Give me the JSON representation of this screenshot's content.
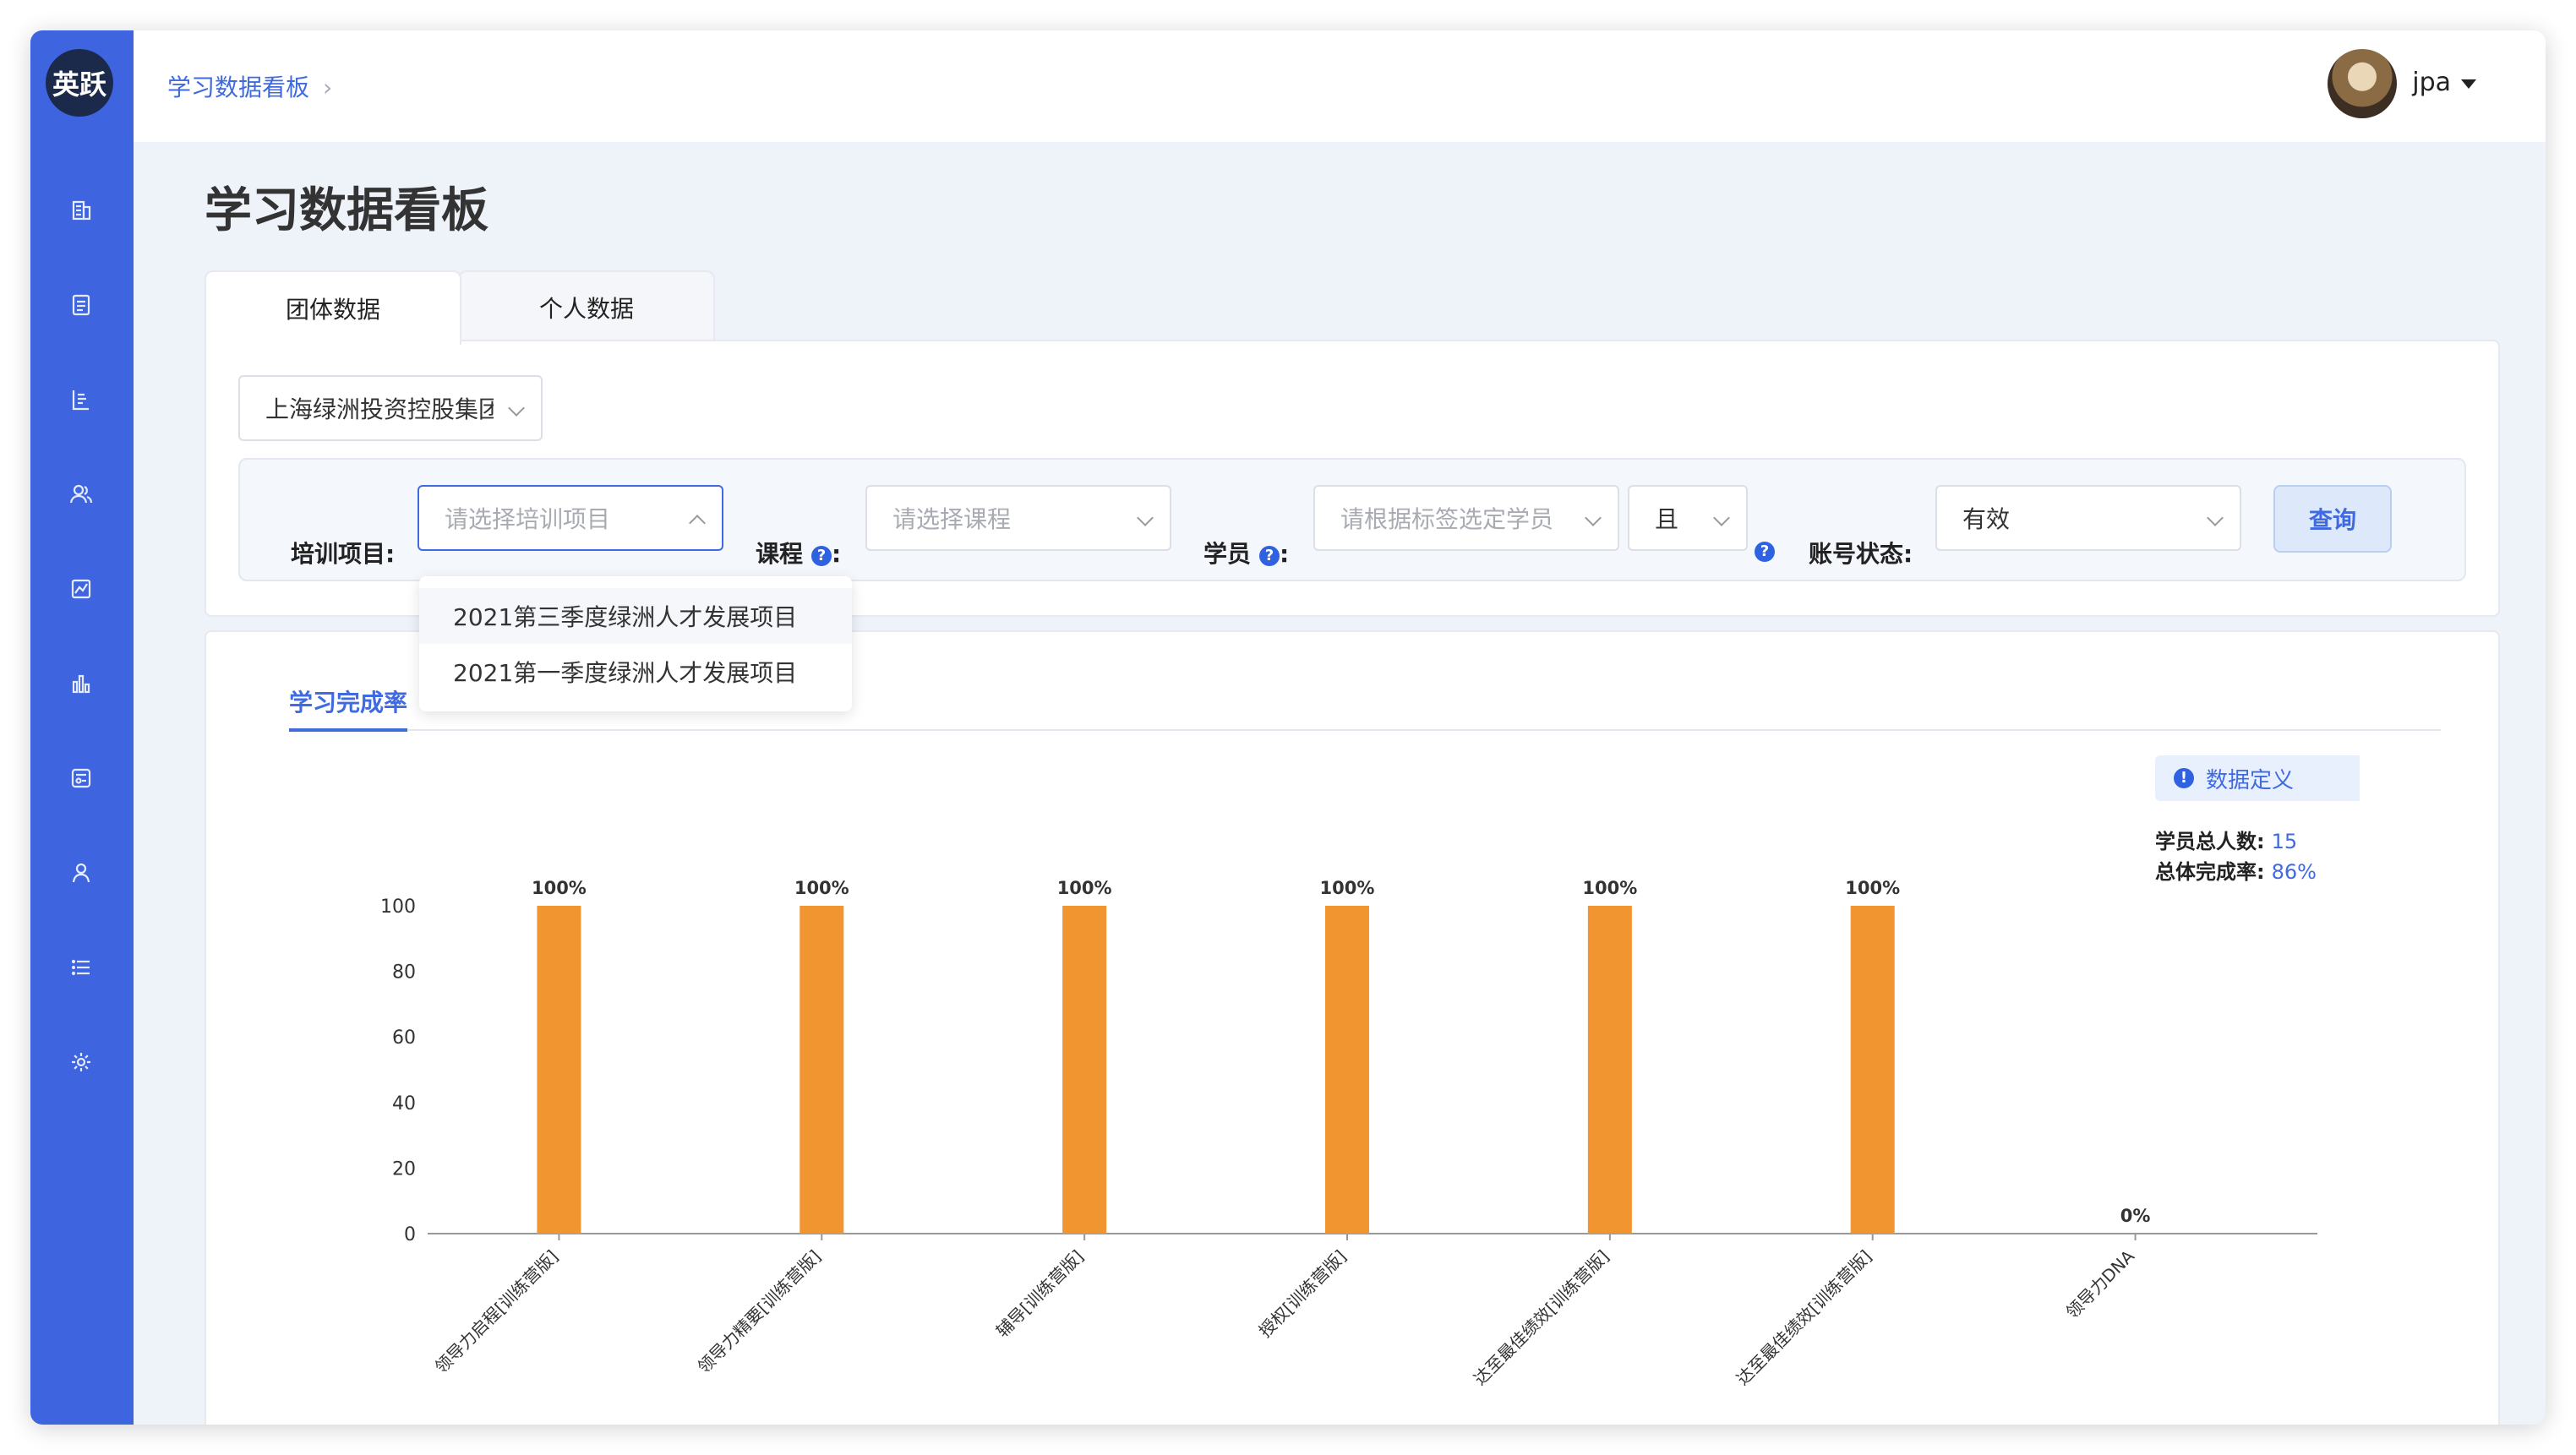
{
  "app": {
    "logo_text": "英跃"
  },
  "sidebar": {
    "icons": [
      "building-icon",
      "document-icon",
      "report-icon",
      "users-icon",
      "analytics-icon",
      "bar-chart-icon",
      "data-panel-icon",
      "person-icon",
      "list-icon",
      "gear-icon"
    ]
  },
  "header": {
    "breadcrumb": "学习数据看板",
    "username": "jpa"
  },
  "page": {
    "title": "学习数据看板"
  },
  "tabs": [
    {
      "label": "团体数据",
      "active": true
    },
    {
      "label": "个人数据",
      "active": false
    }
  ],
  "filters": {
    "company_value": "上海绿洲投资控股集团",
    "training_label": "培训项目",
    "training_placeholder": "请选择培训项目",
    "course_label": "课程",
    "course_placeholder": "请选择课程",
    "student_label": "学员",
    "student_placeholder": "请根据标签选定学员",
    "logic_value": "且",
    "account_label": "账号状态",
    "account_value": "有效",
    "query_label": "查询",
    "colon": ":",
    "help_mark": "?"
  },
  "dropdown": {
    "options": [
      "2021第三季度绿洲人才发展项目",
      "2021第一季度绿洲人才发展项目"
    ]
  },
  "chart_section": {
    "tab_label": "学习完成率",
    "definition_label": "数据定义",
    "total_students_label": "学员总人数:",
    "total_students_value": "15",
    "overall_rate_label": "总体完成率:",
    "overall_rate_value": "86%"
  },
  "chart_data": {
    "type": "bar",
    "categories": [
      "领导力启程[训练营版]",
      "领导力精要[训练营版]",
      "辅导[训练营版]",
      "授权[训练营版]",
      "达至最佳绩效[训练营版]",
      "达至最佳绩效[训练营版]",
      "领导力DNA"
    ],
    "values": [
      100,
      100,
      100,
      100,
      100,
      100,
      0
    ],
    "data_labels": [
      "100%",
      "100%",
      "100%",
      "100%",
      "100%",
      "100%",
      "0%"
    ],
    "ylim": [
      0,
      100
    ],
    "yticks": [
      0,
      20,
      40,
      60,
      80,
      100
    ],
    "bar_color": "#f0952f",
    "grid": false
  },
  "colors": {
    "accent": "#3f64e0",
    "bar": "#f0952f"
  }
}
